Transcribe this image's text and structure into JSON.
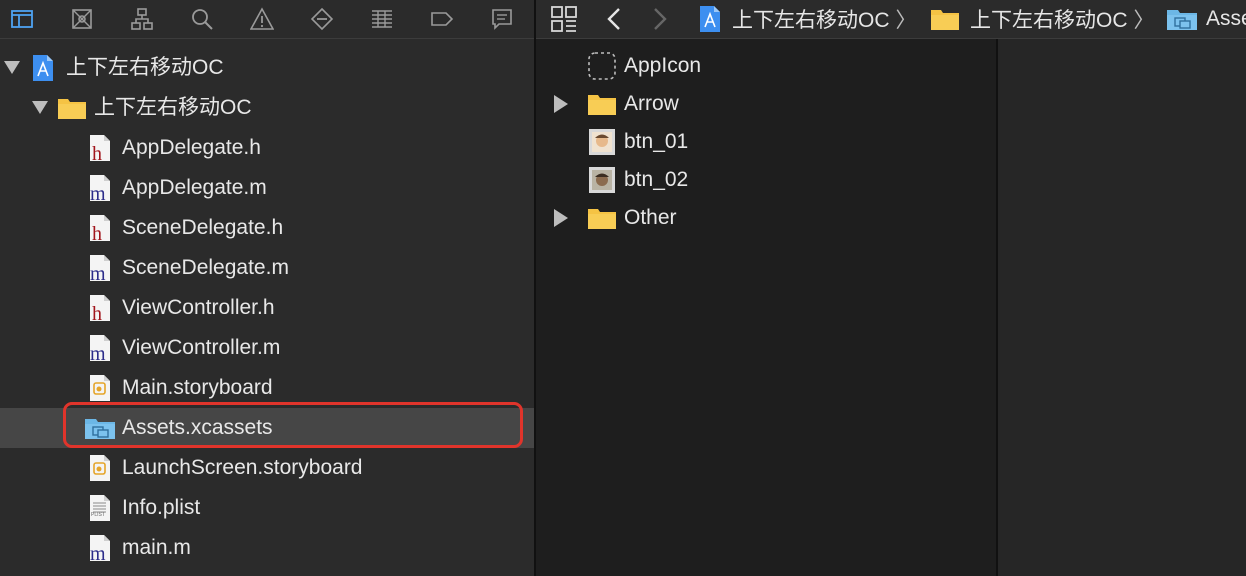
{
  "navigator": {
    "toolbar_icons": [
      "folder-icon",
      "source-control-icon",
      "hierarchy-icon",
      "search-icon",
      "warning-icon",
      "test-icon",
      "debug-icon",
      "breakpoint-icon",
      "report-icon"
    ],
    "items": [
      {
        "label": "上下左右移动OC",
        "icon": "xcodeproj-icon",
        "disclosure": "expanded"
      },
      {
        "label": "上下左右移动OC",
        "icon": "folder-icon",
        "disclosure": "expanded"
      },
      {
        "label": "AppDelegate.h",
        "icon": "h-file-icon",
        "badge": "h"
      },
      {
        "label": "AppDelegate.m",
        "icon": "m-file-icon",
        "badge": "m"
      },
      {
        "label": "SceneDelegate.h",
        "icon": "h-file-icon",
        "badge": "h"
      },
      {
        "label": "SceneDelegate.m",
        "icon": "m-file-icon",
        "badge": "m"
      },
      {
        "label": "ViewController.h",
        "icon": "h-file-icon",
        "badge": "h"
      },
      {
        "label": "ViewController.m",
        "icon": "m-file-icon",
        "badge": "m"
      },
      {
        "label": "Main.storyboard",
        "icon": "storyboard-icon"
      },
      {
        "label": "Assets.xcassets",
        "icon": "xcassets-icon",
        "selected": true
      },
      {
        "label": "LaunchScreen.storyboard",
        "icon": "storyboard-icon"
      },
      {
        "label": "Info.plist",
        "icon": "plist-icon",
        "badge": "PLIST"
      },
      {
        "label": "main.m",
        "icon": "m-file-icon",
        "badge": "m"
      }
    ]
  },
  "jumpbar": {
    "crumbs": [
      {
        "label": "上下左右移动OC",
        "icon": "xcodeproj-icon"
      },
      {
        "label": "上下左右移动OC",
        "icon": "folder-icon"
      },
      {
        "label": "Asse",
        "icon": "xcassets-icon"
      }
    ]
  },
  "assets": {
    "items": [
      {
        "label": "AppIcon",
        "icon": "appicon-placeholder-icon",
        "disclosure": "none"
      },
      {
        "label": "Arrow",
        "icon": "folder-icon",
        "disclosure": "collapsed"
      },
      {
        "label": "btn_01",
        "icon": "image-thumbnail-icon",
        "disclosure": "none"
      },
      {
        "label": "btn_02",
        "icon": "image-thumbnail-icon",
        "disclosure": "none"
      },
      {
        "label": "Other",
        "icon": "folder-icon",
        "disclosure": "collapsed"
      }
    ]
  },
  "colors": {
    "selection_outline": "#e0342b",
    "folder_yellow": "#f5c344",
    "xcassets_blue": "#6cb7e6",
    "h_letter": "#a2151c",
    "m_letter": "#2c2c8a"
  }
}
